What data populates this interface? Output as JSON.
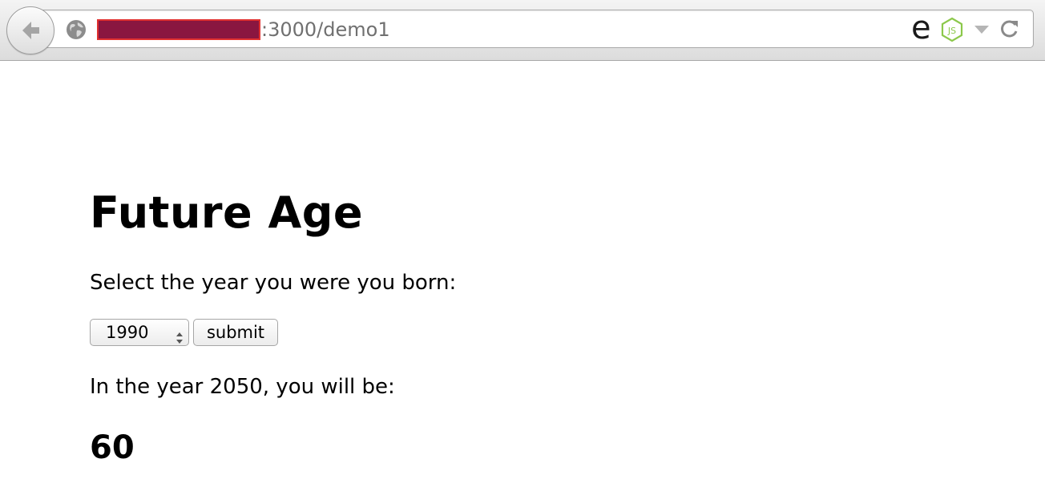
{
  "browser": {
    "url_suffix": ":3000/demo1",
    "icons": {
      "back": "back-arrow-icon",
      "site": "globe-icon",
      "extension_e": "e-extension-icon",
      "extension_node": "nodejs-icon",
      "dropdown": "dropdown-triangle-icon",
      "reload": "reload-icon"
    },
    "extension_e_glyph": "e",
    "redaction_color": "#8a1640"
  },
  "page": {
    "title": "Future Age",
    "prompt": "Select the year you were you born:",
    "year_select": {
      "selected": "1990"
    },
    "submit_label": "submit",
    "result_label": "In the year 2050, you will be:",
    "result_value": "60"
  }
}
